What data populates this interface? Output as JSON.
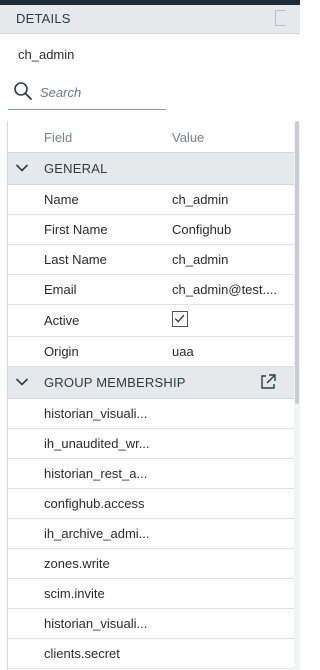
{
  "panel": {
    "title": "DETAILS"
  },
  "user": {
    "name": "ch_admin"
  },
  "search": {
    "placeholder": "Search",
    "value": ""
  },
  "columns": {
    "field": "Field",
    "value": "Value"
  },
  "general": {
    "label": "GENERAL",
    "rows": [
      {
        "field": "Name",
        "value": "ch_admin"
      },
      {
        "field": "First Name",
        "value": "Confighub"
      },
      {
        "field": "Last Name",
        "value": "ch_admin"
      },
      {
        "field": "Email",
        "value": "ch_admin@test...."
      },
      {
        "field": "Active",
        "value": ""
      },
      {
        "field": "Origin",
        "value": "uaa"
      }
    ],
    "active_checked": true
  },
  "group_membership": {
    "label": "GROUP MEMBERSHIP",
    "items": [
      "historian_visuali...",
      "ih_unaudited_wr...",
      "historian_rest_a...",
      "confighub.access",
      "ih_archive_admi...",
      "zones.write",
      "scim.invite",
      "historian_visuali...",
      "clients.secret"
    ]
  },
  "icons": {
    "search": "search-icon",
    "chevron": "chevron-down-icon",
    "external": "external-link-icon",
    "check": "check-icon"
  },
  "colors": {
    "header_bg": "#e6e9ec",
    "topbar": "#1f2c36"
  }
}
